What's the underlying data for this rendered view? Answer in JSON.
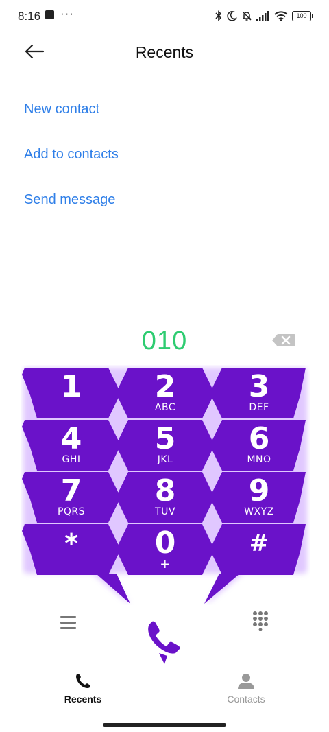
{
  "status_bar": {
    "time": "8:16",
    "overflow": "···",
    "battery": "100",
    "icons": [
      "bluetooth-icon",
      "moon-icon",
      "bell-off-icon",
      "signal-icon",
      "wifi-icon",
      "battery-icon"
    ]
  },
  "header": {
    "title": "Recents"
  },
  "actions": [
    {
      "label": "New contact"
    },
    {
      "label": "Add to contacts"
    },
    {
      "label": "Send message"
    }
  ],
  "dialer": {
    "number": "010",
    "keys": [
      {
        "digit": "1",
        "letters": ""
      },
      {
        "digit": "2",
        "letters": "ABC"
      },
      {
        "digit": "3",
        "letters": "DEF"
      },
      {
        "digit": "4",
        "letters": "GHI"
      },
      {
        "digit": "5",
        "letters": "JKL"
      },
      {
        "digit": "6",
        "letters": "MNO"
      },
      {
        "digit": "7",
        "letters": "PQRS"
      },
      {
        "digit": "8",
        "letters": "TUV"
      },
      {
        "digit": "9",
        "letters": "WXYZ"
      },
      {
        "digit": "*",
        "letters": ""
      },
      {
        "digit": "0",
        "letters": "+"
      },
      {
        "digit": "#",
        "letters": ""
      }
    ]
  },
  "bottom_nav": {
    "recents": "Recents",
    "contacts": "Contacts"
  },
  "colors": {
    "accent_link": "#2f7fe8",
    "number": "#2ecc71",
    "key_purple": "#6a12c9",
    "key_glow": "#c79bff"
  }
}
